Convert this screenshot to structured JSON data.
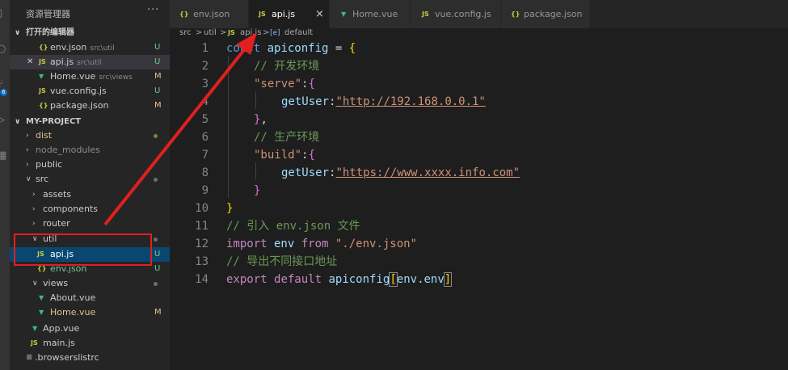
{
  "activity": {
    "badge": "6"
  },
  "explorer": {
    "title": "资源管理器",
    "more": "···",
    "open_editors_title": "打开的编辑器",
    "open_editors": [
      {
        "icon": "{}",
        "name": "env.json",
        "path": "src\\util",
        "status": "U"
      },
      {
        "icon": "JS",
        "name": "api.js",
        "path": "src\\util",
        "status": "U"
      },
      {
        "icon": "V",
        "name": "Home.vue",
        "path": "src\\views",
        "status": "M"
      },
      {
        "icon": "JS",
        "name": "vue.config.js",
        "path": "",
        "status": "U"
      },
      {
        "icon": "{}",
        "name": "package.json",
        "path": "",
        "status": "M"
      }
    ],
    "project_title": "MY-PROJECT",
    "tree": [
      {
        "name": "dist"
      },
      {
        "name": "node_modules"
      },
      {
        "name": "public"
      },
      {
        "name": "src"
      },
      {
        "name": "assets"
      },
      {
        "name": "components"
      },
      {
        "name": "router"
      },
      {
        "name": "util"
      },
      {
        "name": "api.js",
        "icon": "JS",
        "status": "U"
      },
      {
        "name": "env.json",
        "icon": "{}",
        "status": "U"
      },
      {
        "name": "views"
      },
      {
        "name": "About.vue",
        "icon": "V"
      },
      {
        "name": "Home.vue",
        "icon": "V",
        "status": "M"
      },
      {
        "name": "App.vue",
        "icon": "V"
      },
      {
        "name": "main.js",
        "icon": "JS"
      },
      {
        "name": ".browserslistrc",
        "icon": "≡"
      }
    ]
  },
  "tabs": [
    {
      "icon": "{}",
      "label": "env.json"
    },
    {
      "icon": "JS",
      "label": "api.js",
      "close": "×"
    },
    {
      "icon": "V",
      "label": "Home.vue"
    },
    {
      "icon": "JS",
      "label": "vue.config.js"
    },
    {
      "icon": "{}",
      "label": "package.json"
    }
  ],
  "breadcrumb": [
    "src",
    ">",
    "util",
    ">",
    "JS",
    "api.js",
    ">",
    "[e]",
    "default"
  ],
  "code": {
    "line_numbers": [
      "1",
      "2",
      "3",
      "4",
      "5",
      "6",
      "7",
      "8",
      "9",
      "10",
      "11",
      "12",
      "13",
      "14"
    ],
    "l1": [
      "const",
      " apiconfig",
      " = ",
      "{"
    ],
    "l2": "// 开发环境",
    "l3": [
      "\"serve\"",
      ":",
      "{"
    ],
    "l4": [
      "getUser",
      ":",
      "\"http://192.168.0.0.1\""
    ],
    "l5": [
      "}",
      ","
    ],
    "l6": "// 生产环境",
    "l7": [
      "\"build\"",
      ":",
      "{"
    ],
    "l8": [
      "getUser",
      ":",
      "\"https://www.xxxx.info.com\""
    ],
    "l9": "}",
    "l10": "}",
    "l11": "// 引入 env.json 文件",
    "l12": [
      "import",
      " env ",
      "from",
      " \"./env.json\""
    ],
    "l13": "// 导出不同接口地址",
    "l14": [
      "export",
      " ",
      "default",
      " apiconfig",
      "[",
      "env",
      ".",
      "env",
      "]"
    ]
  },
  "colors": {
    "annotation": "#e02020",
    "selection": "#094771"
  }
}
